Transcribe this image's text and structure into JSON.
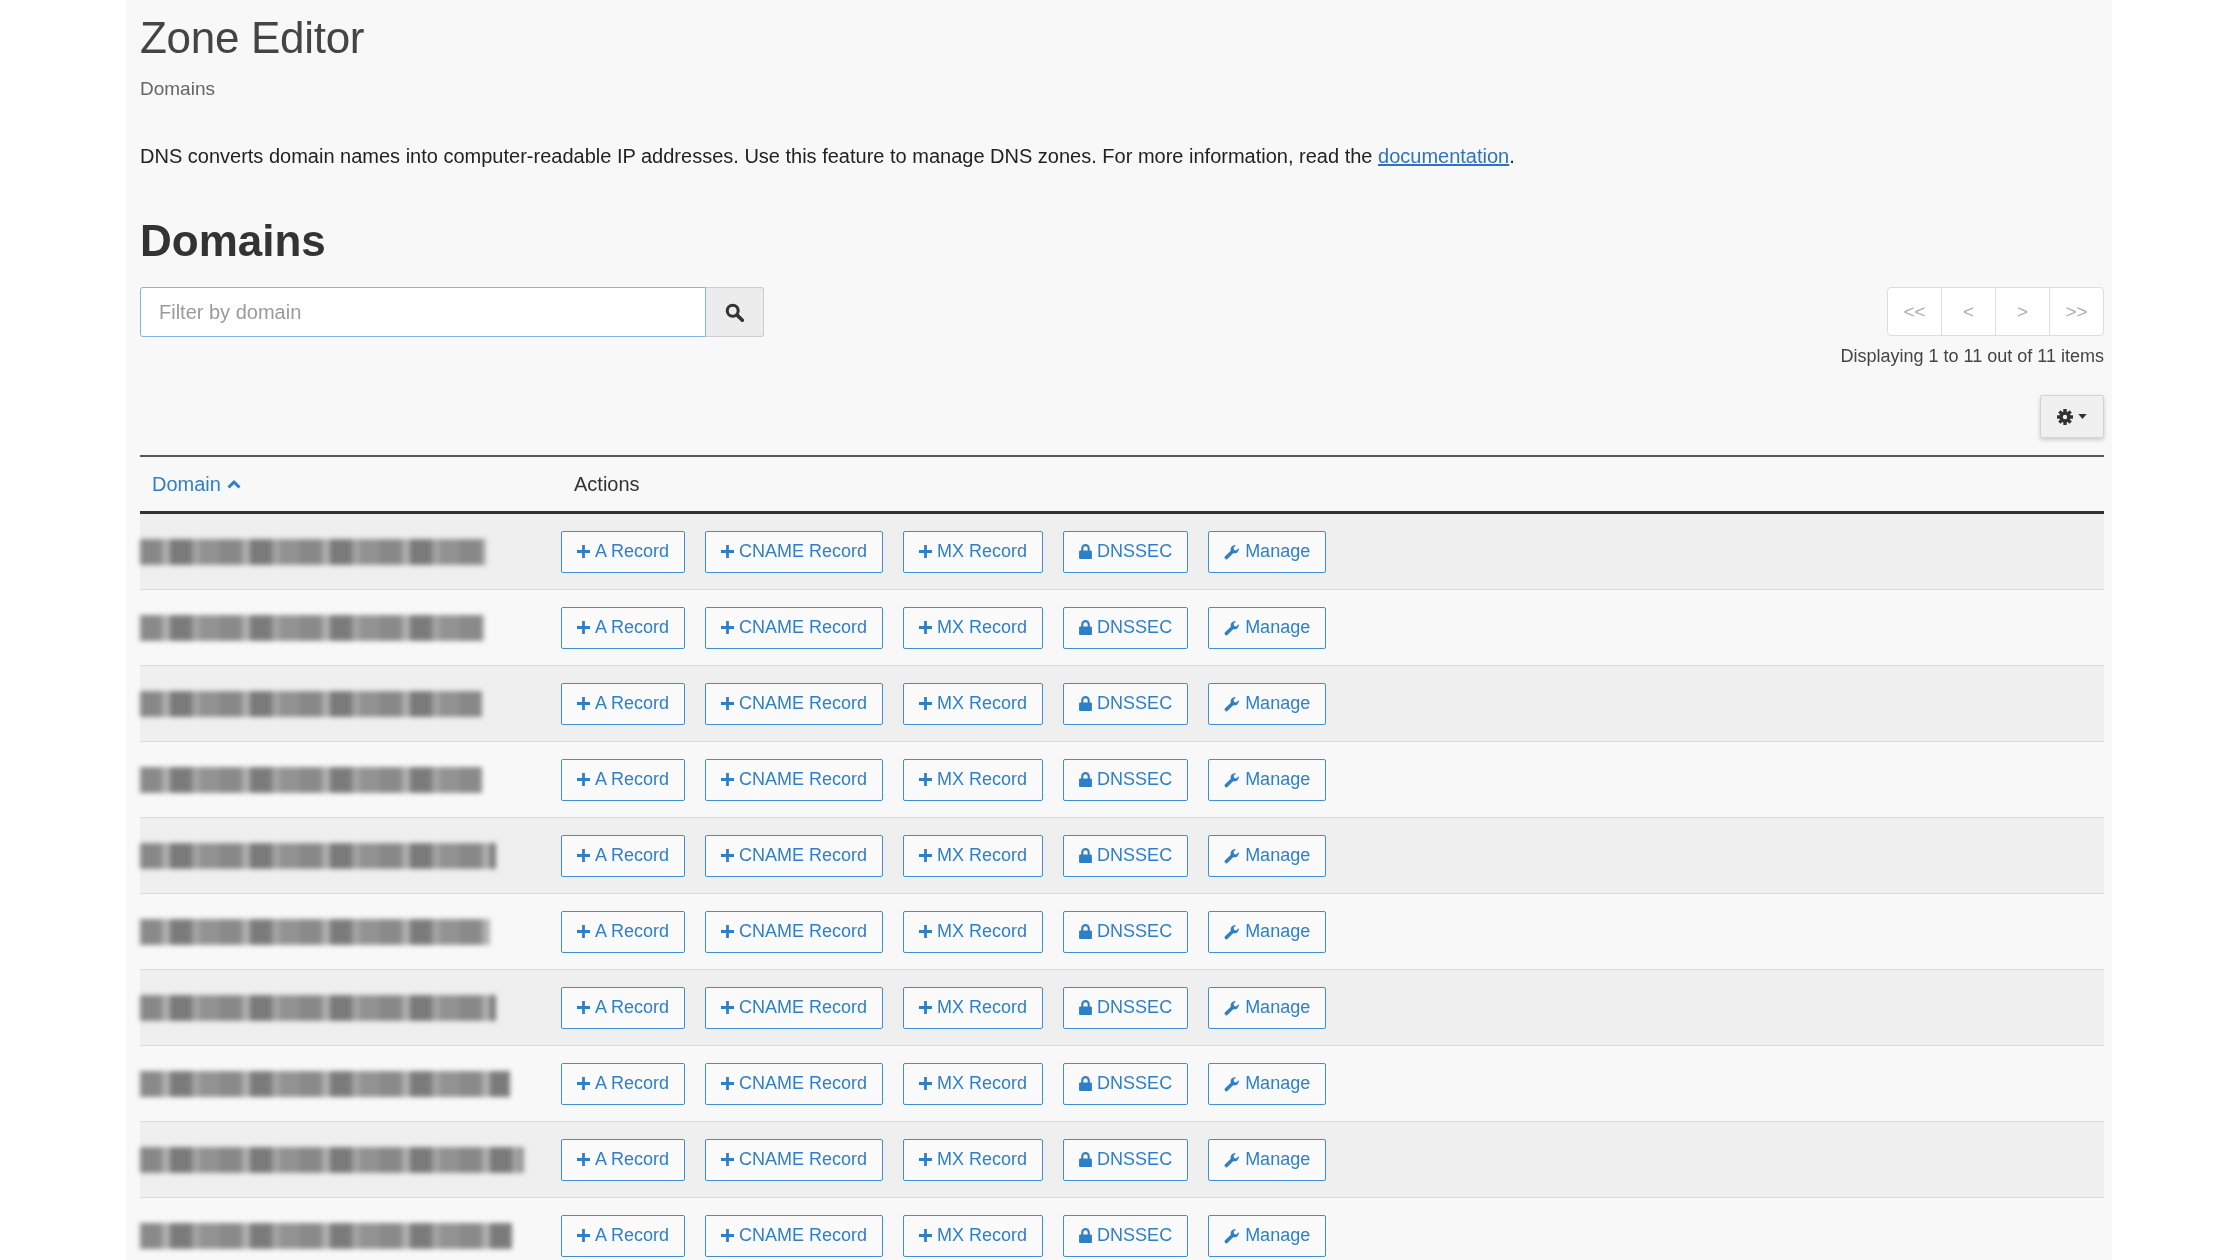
{
  "header": {
    "title": "Zone Editor",
    "subtitle": "Domains"
  },
  "description": {
    "before": "DNS converts domain names into computer-readable IP addresses. Use this feature to manage DNS zones. For more information, read the ",
    "link": "documentation",
    "after": "."
  },
  "section": {
    "heading": "Domains",
    "search": {
      "placeholder": "Filter by domain"
    },
    "pagination": {
      "buttons": [
        {
          "label": "<<",
          "disabled": true
        },
        {
          "label": "<",
          "disabled": true
        },
        {
          "label": ">",
          "disabled": true
        },
        {
          "label": ">>",
          "disabled": true
        }
      ],
      "summary": "Displaying 1 to 11 out of 11 items"
    },
    "table": {
      "columns": [
        {
          "label": "Domain",
          "sorted": true
        },
        {
          "label": "Actions",
          "sorted": false
        }
      ],
      "rows": [
        {
          "actions": [
            {
              "label": "A Record",
              "kind": "add"
            },
            {
              "label": "CNAME Record",
              "kind": "add"
            },
            {
              "label": "MX Record",
              "kind": "add"
            },
            {
              "label": "DNSSEC",
              "kind": "secure"
            },
            {
              "label": "Manage",
              "kind": "manage"
            }
          ]
        },
        {
          "actions": [
            {
              "label": "A Record",
              "kind": "add"
            },
            {
              "label": "CNAME Record",
              "kind": "add"
            },
            {
              "label": "MX Record",
              "kind": "add"
            },
            {
              "label": "DNSSEC",
              "kind": "secure"
            },
            {
              "label": "Manage",
              "kind": "manage"
            }
          ]
        },
        {
          "actions": [
            {
              "label": "A Record",
              "kind": "add"
            },
            {
              "label": "CNAME Record",
              "kind": "add"
            },
            {
              "label": "MX Record",
              "kind": "add"
            },
            {
              "label": "DNSSEC",
              "kind": "secure"
            },
            {
              "label": "Manage",
              "kind": "manage"
            }
          ]
        },
        {
          "actions": [
            {
              "label": "A Record",
              "kind": "add"
            },
            {
              "label": "CNAME Record",
              "kind": "add"
            },
            {
              "label": "MX Record",
              "kind": "add"
            },
            {
              "label": "DNSSEC",
              "kind": "secure"
            },
            {
              "label": "Manage",
              "kind": "manage"
            }
          ]
        },
        {
          "actions": [
            {
              "label": "A Record",
              "kind": "add"
            },
            {
              "label": "CNAME Record",
              "kind": "add"
            },
            {
              "label": "MX Record",
              "kind": "add"
            },
            {
              "label": "DNSSEC",
              "kind": "secure"
            },
            {
              "label": "Manage",
              "kind": "manage"
            }
          ]
        },
        {
          "actions": [
            {
              "label": "A Record",
              "kind": "add"
            },
            {
              "label": "CNAME Record",
              "kind": "add"
            },
            {
              "label": "MX Record",
              "kind": "add"
            },
            {
              "label": "DNSSEC",
              "kind": "secure"
            },
            {
              "label": "Manage",
              "kind": "manage"
            }
          ]
        },
        {
          "actions": [
            {
              "label": "A Record",
              "kind": "add"
            },
            {
              "label": "CNAME Record",
              "kind": "add"
            },
            {
              "label": "MX Record",
              "kind": "add"
            },
            {
              "label": "DNSSEC",
              "kind": "secure"
            },
            {
              "label": "Manage",
              "kind": "manage"
            }
          ]
        },
        {
          "actions": [
            {
              "label": "A Record",
              "kind": "add"
            },
            {
              "label": "CNAME Record",
              "kind": "add"
            },
            {
              "label": "MX Record",
              "kind": "add"
            },
            {
              "label": "DNSSEC",
              "kind": "secure"
            },
            {
              "label": "Manage",
              "kind": "manage"
            }
          ]
        },
        {
          "actions": [
            {
              "label": "A Record",
              "kind": "add"
            },
            {
              "label": "CNAME Record",
              "kind": "add"
            },
            {
              "label": "MX Record",
              "kind": "add"
            },
            {
              "label": "DNSSEC",
              "kind": "secure"
            },
            {
              "label": "Manage",
              "kind": "manage"
            }
          ]
        },
        {
          "actions": [
            {
              "label": "A Record",
              "kind": "add"
            },
            {
              "label": "CNAME Record",
              "kind": "add"
            },
            {
              "label": "MX Record",
              "kind": "add"
            },
            {
              "label": "DNSSEC",
              "kind": "secure"
            },
            {
              "label": "Manage",
              "kind": "manage"
            }
          ]
        }
      ]
    }
  }
}
